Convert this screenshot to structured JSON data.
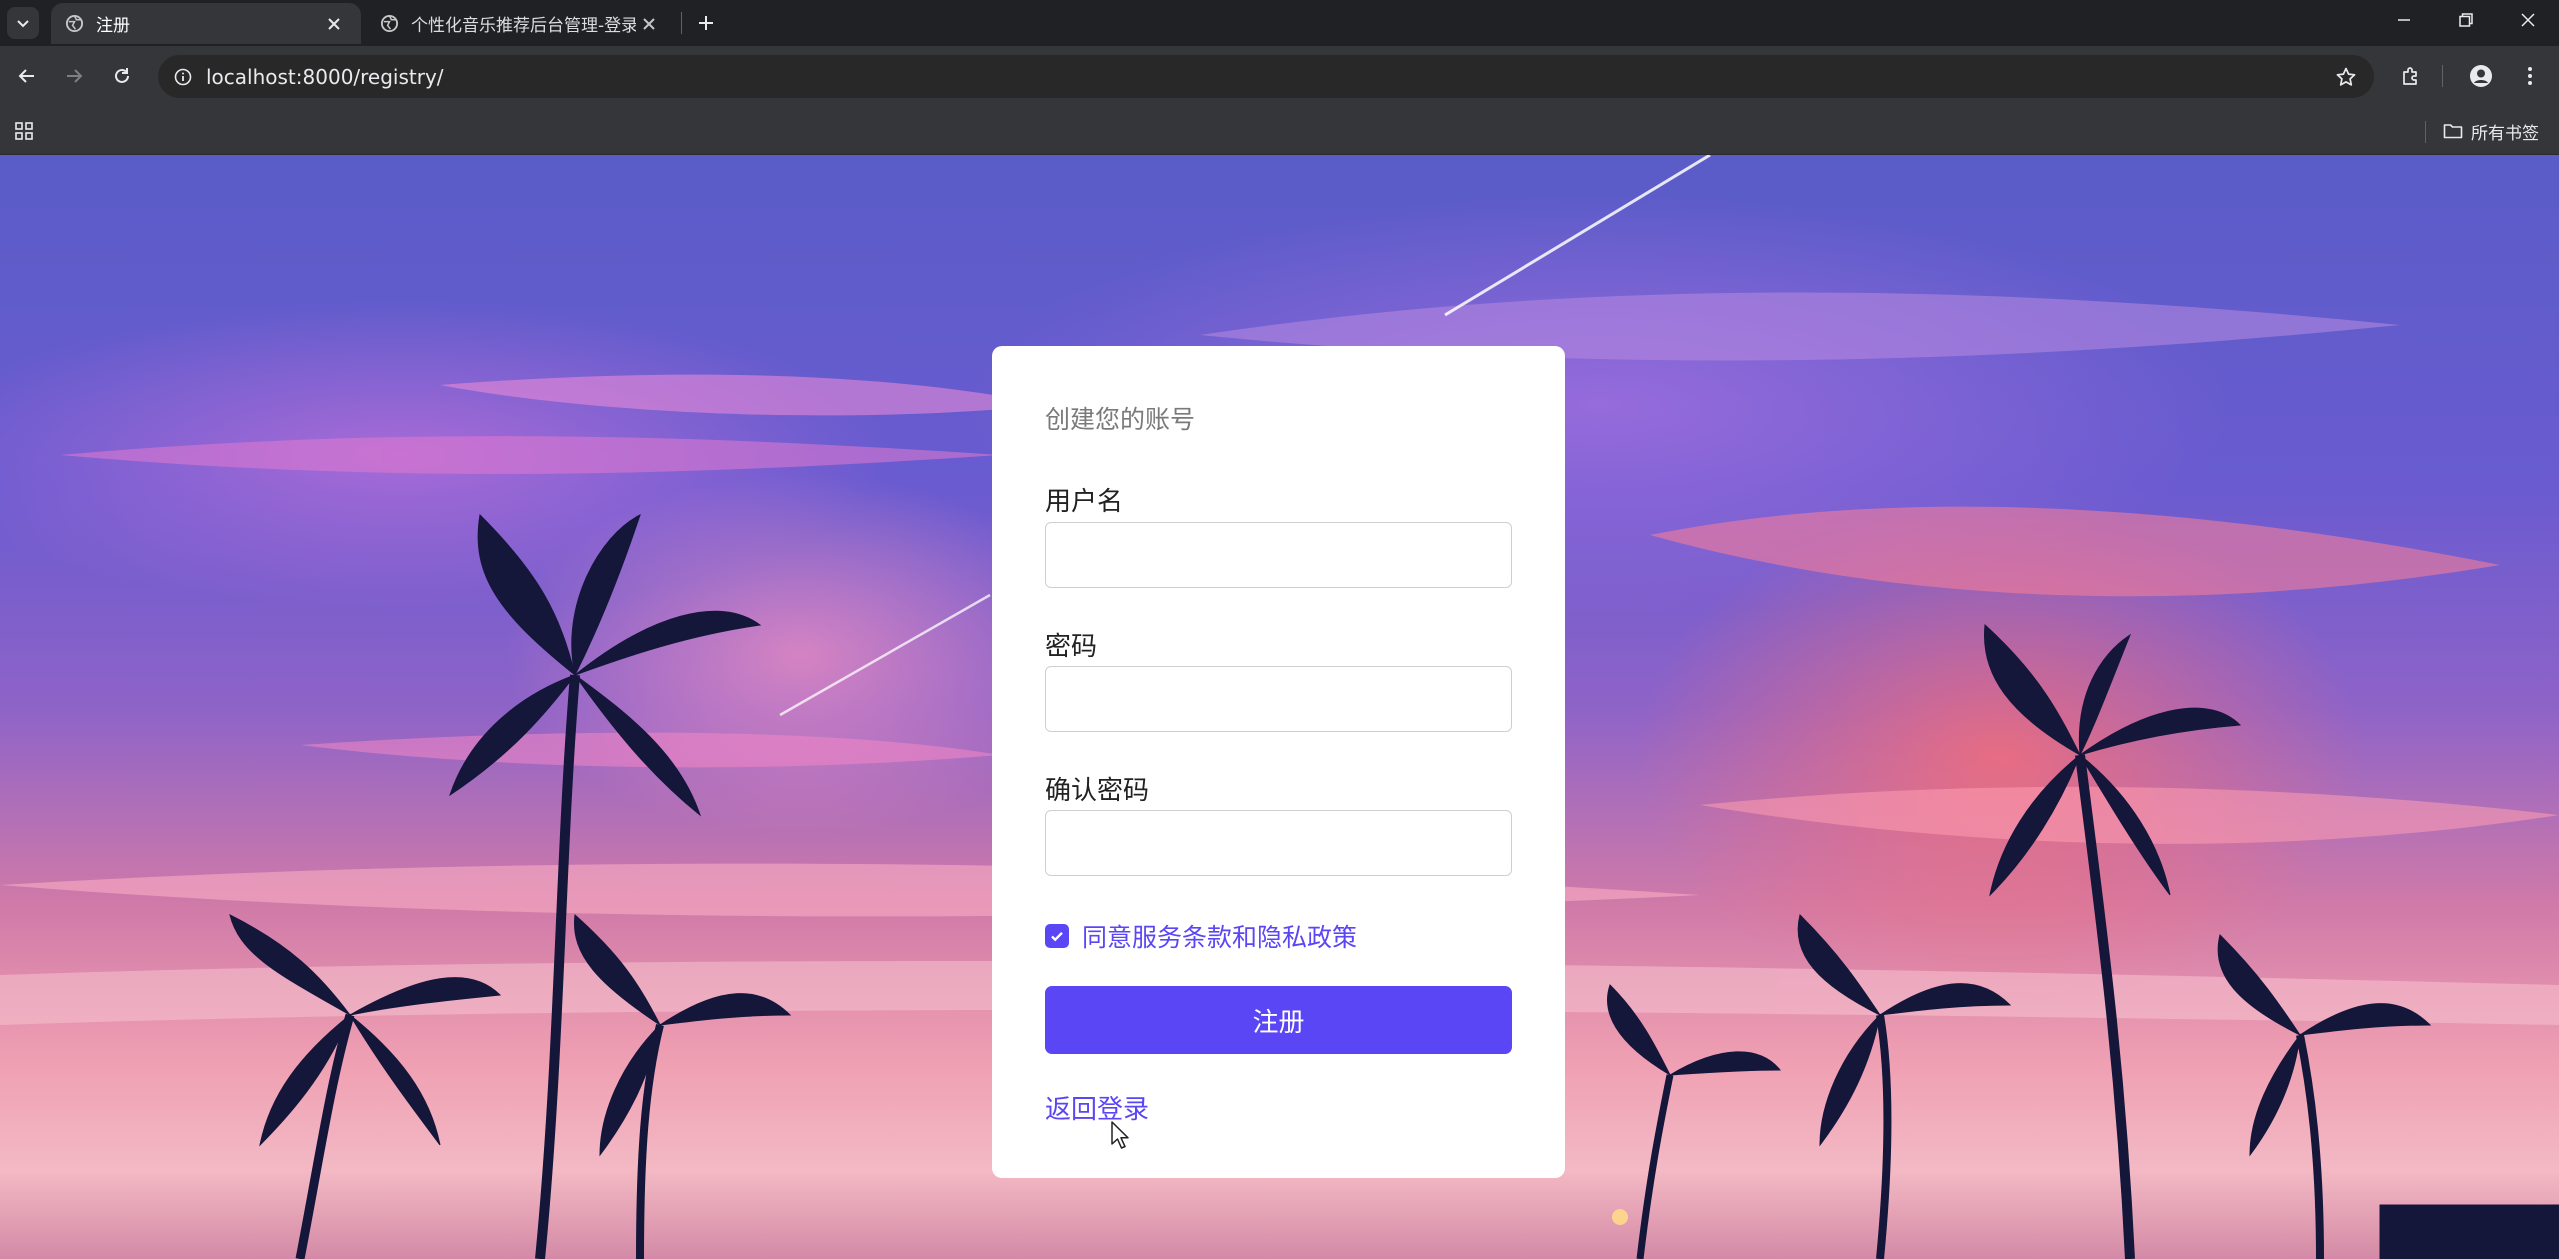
{
  "browser": {
    "tabs": [
      {
        "title": "注册",
        "active": true
      },
      {
        "title": "个性化音乐推荐后台管理-登录",
        "active": false
      }
    ],
    "url": "localhost:8000/registry/",
    "bookmarks_folder": "所有书签"
  },
  "form": {
    "heading": "创建您的账号",
    "username_label": "用户名",
    "username_value": "",
    "password_label": "密码",
    "password_value": "",
    "confirm_label": "确认密码",
    "confirm_value": "",
    "agree_text": "同意服务条款和隐私政策",
    "agree_checked": true,
    "submit_label": "注册",
    "back_link": "返回登录"
  },
  "colors": {
    "accent": "#5b46f5",
    "chrome_dark": "#202124",
    "chrome_toolbar": "#35363a"
  }
}
